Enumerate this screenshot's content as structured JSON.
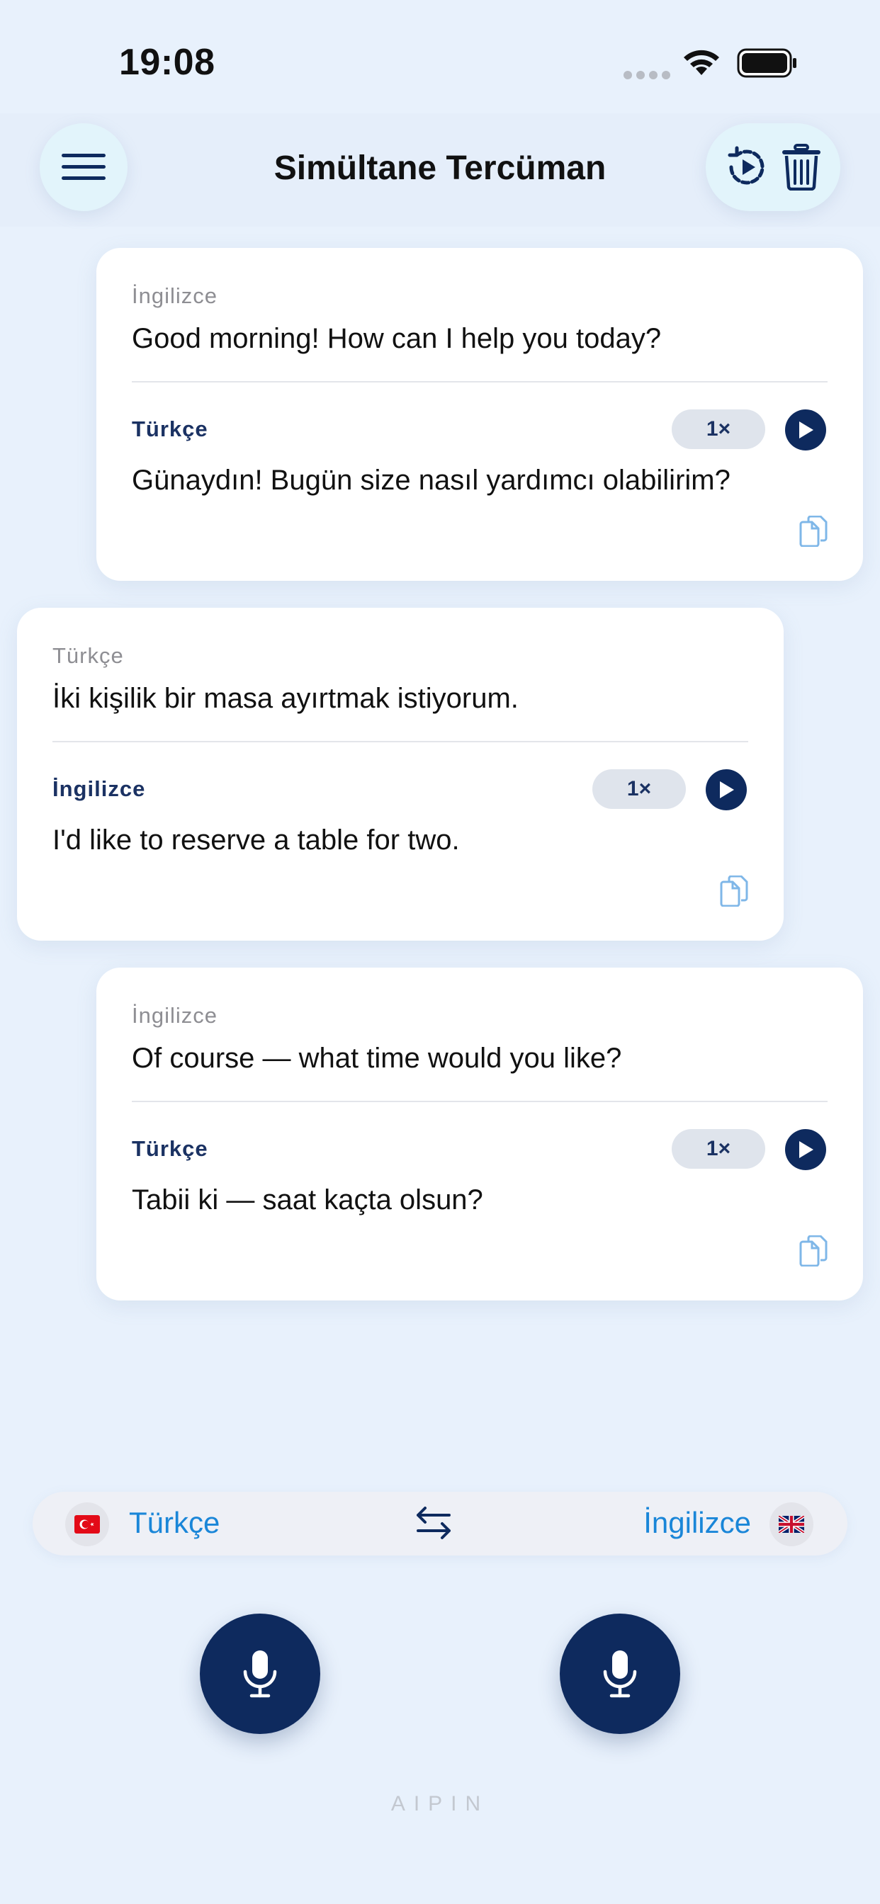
{
  "status": {
    "time": "19:08"
  },
  "header": {
    "title": "Simültane Tercüman"
  },
  "cards": [
    {
      "source_lang": "İngilizce",
      "source_text": "Good morning! How can I help you today?",
      "target_lang": "Türkçe",
      "target_text": "Günaydın! Bugün size nasıl yardımcı olabilirim?",
      "speed": "1×"
    },
    {
      "source_lang": "Türkçe",
      "source_text": "İki kişilik bir masa ayırtmak istiyorum.",
      "target_lang": "İngilizce",
      "target_text": "I'd like to reserve a table for two.",
      "speed": "1×"
    },
    {
      "source_lang": "İngilizce",
      "source_text": "Of course — what time would you like?",
      "target_lang": "Türkçe",
      "target_text": "Tabii ki — saat kaçta olsun?",
      "speed": "1×"
    }
  ],
  "language_bar": {
    "left_lang": "Türkçe",
    "left_flag": "turkey-flag",
    "right_lang": "İngilizce",
    "right_flag": "uk-flag"
  },
  "brand": "AIPIN",
  "colors": {
    "accent": "#0e2a5e",
    "link": "#1a86d8",
    "background": "#e8f1fc"
  }
}
